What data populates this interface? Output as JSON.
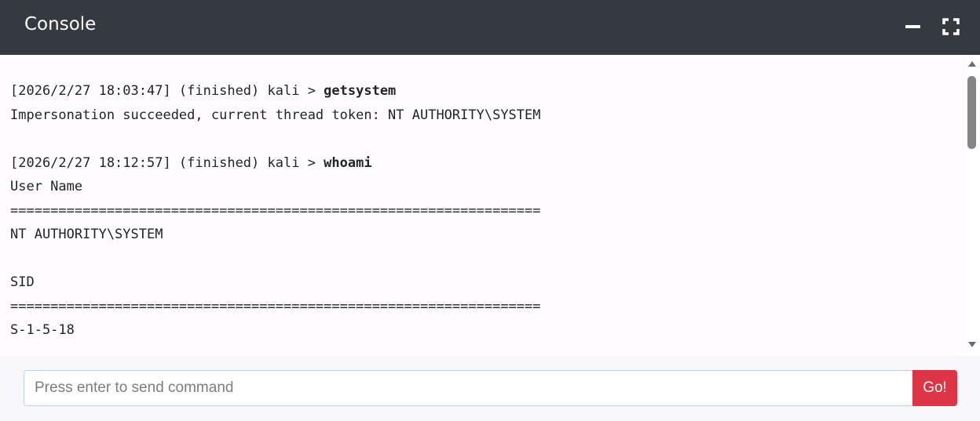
{
  "window": {
    "title": "Console"
  },
  "output": {
    "lines": [
      {
        "prefix": "[2026/2/27 18:03:47] (finished) kali > ",
        "cmd": "getsystem"
      },
      {
        "text": "Impersonation succeeded, current thread token: NT AUTHORITY\\SYSTEM"
      },
      {
        "text": ""
      },
      {
        "prefix": "[2026/2/27 18:12:57] (finished) kali > ",
        "cmd": "whoami"
      },
      {
        "text": "User Name"
      },
      {
        "text": "=================================================================="
      },
      {
        "text": "NT AUTHORITY\\SYSTEM"
      },
      {
        "text": ""
      },
      {
        "text": "SID"
      },
      {
        "text": "=================================================================="
      },
      {
        "text": "S-1-5-18"
      }
    ]
  },
  "command": {
    "placeholder": "Press enter to send command",
    "value": "",
    "button_label": "Go!"
  },
  "colors": {
    "titlebar": "#343a40",
    "go_button": "#dc3545"
  },
  "icons": {
    "minimize": "minimize-icon",
    "maximize": "fullscreen-icon"
  }
}
